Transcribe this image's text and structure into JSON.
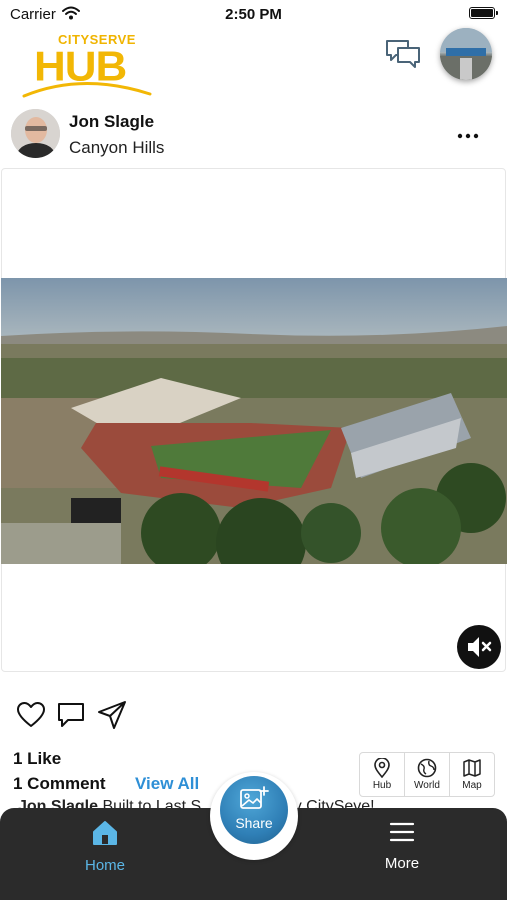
{
  "status_bar": {
    "carrier": "Carrier",
    "time": "2:50 PM"
  },
  "header": {
    "logo_top": "CITYSERVE",
    "logo_main": "HUB",
    "colors": {
      "brand": "#f2b705"
    }
  },
  "post": {
    "author": "Jon Slagle",
    "location": "Canyon Hills",
    "likes": "1 Like",
    "comments": "1 Comment",
    "view_all": "View All",
    "caption_author": "Jon Slagle",
    "caption_text": "Built to Last S... powered by CitySeve!"
  },
  "view_switch": {
    "items": [
      {
        "label": "Hub",
        "icon": "map-pin-icon"
      },
      {
        "label": "World",
        "icon": "globe-icon"
      },
      {
        "label": "Map",
        "icon": "map-icon"
      }
    ]
  },
  "bottom_nav": {
    "home": "Home",
    "share": "Share",
    "more": "More",
    "colors": {
      "active": "#5bb6e6",
      "background": "#2b2b2b"
    }
  }
}
